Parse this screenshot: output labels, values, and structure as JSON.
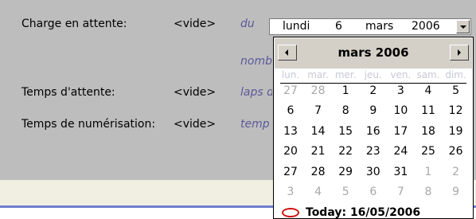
{
  "form": {
    "rows": [
      {
        "label": "Charge en attente:",
        "value": "<vide>",
        "hint": "du"
      },
      {
        "label": "",
        "value": "",
        "hint": "nomb"
      },
      {
        "label": "Temps d'attente:",
        "value": "<vide>",
        "hint": "laps d"
      },
      {
        "label": "Temps de numérisation:",
        "value": "<vide>",
        "hint": "temp"
      }
    ]
  },
  "date_picker": {
    "weekday": "lundi",
    "day": "6",
    "month": "mars",
    "year": "2006"
  },
  "calendar": {
    "title": "mars 2006",
    "weekdays": [
      "lun.",
      "mar.",
      "mer.",
      "jeu.",
      "ven.",
      "sam.",
      "dim."
    ],
    "weeks": [
      [
        "27",
        "28",
        "1",
        "2",
        "3",
        "4",
        "5"
      ],
      [
        "6",
        "7",
        "8",
        "9",
        "10",
        "11",
        "12"
      ],
      [
        "13",
        "14",
        "15",
        "16",
        "17",
        "18",
        "19"
      ],
      [
        "20",
        "21",
        "22",
        "23",
        "24",
        "25",
        "26"
      ],
      [
        "27",
        "28",
        "29",
        "30",
        "31",
        "1",
        "2"
      ],
      [
        "3",
        "4",
        "5",
        "6",
        "7",
        "8",
        "9"
      ]
    ],
    "selected_day": "6",
    "today_label": "Today: 16/05/2006"
  },
  "colors": {
    "panel": "#bdbdbd",
    "hint_text": "#5a5a9a",
    "accent_stripe": "#6e7fd0",
    "today_circle": "#d01010"
  }
}
